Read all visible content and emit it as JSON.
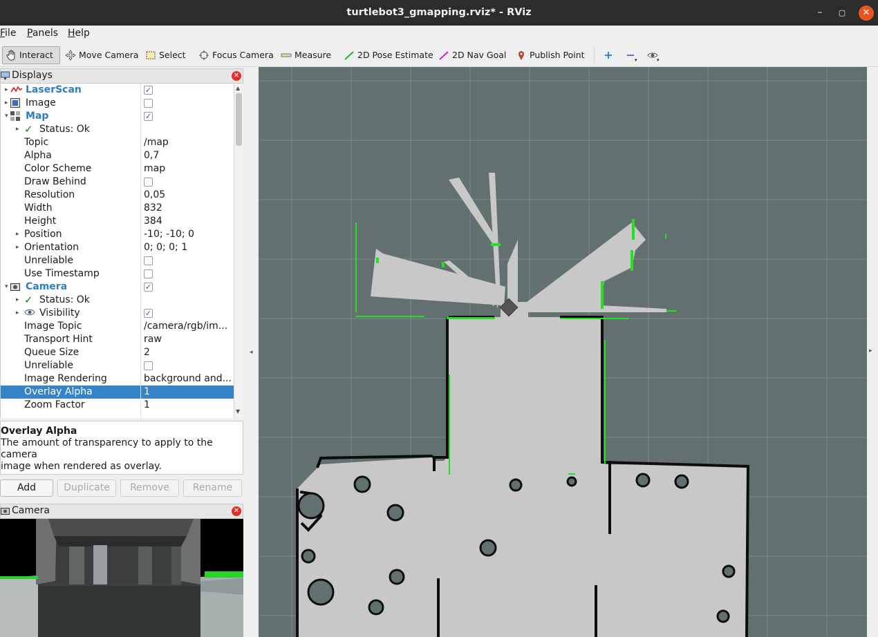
{
  "window": {
    "title": "turtlebot3_gmapping.rviz* - RViz"
  },
  "menu": [
    {
      "label": "File",
      "key": "F",
      "rest": "ile"
    },
    {
      "label": "Panels",
      "key": "P",
      "rest": "anels"
    },
    {
      "label": "Help",
      "key": "H",
      "rest": "elp"
    }
  ],
  "toolbar": {
    "interact": "Interact",
    "move_camera": "Move Camera",
    "select": "Select",
    "focus_camera": "Focus Camera",
    "measure": "Measure",
    "pose_estimate": "2D Pose Estimate",
    "nav_goal": "2D Nav Goal",
    "publish_point": "Publish Point"
  },
  "displays": {
    "title": "Displays",
    "rows": [
      {
        "name": "LaserScan",
        "value": "",
        "checked": true
      },
      {
        "name": "Image",
        "value": "",
        "checked": false
      },
      {
        "name": "Map",
        "value": "",
        "checked": true
      },
      {
        "name": "Status: Ok",
        "value": ""
      },
      {
        "name": "Topic",
        "value": "/map"
      },
      {
        "name": "Alpha",
        "value": "0,7"
      },
      {
        "name": "Color Scheme",
        "value": "map"
      },
      {
        "name": "Draw Behind",
        "value": "",
        "checked": false
      },
      {
        "name": "Resolution",
        "value": "0,05"
      },
      {
        "name": "Width",
        "value": "832"
      },
      {
        "name": "Height",
        "value": "384"
      },
      {
        "name": "Position",
        "value": "-10; -10; 0"
      },
      {
        "name": "Orientation",
        "value": "0; 0; 0; 1"
      },
      {
        "name": "Unreliable",
        "value": "",
        "checked": false
      },
      {
        "name": "Use Timestamp",
        "value": "",
        "checked": false
      },
      {
        "name": "Camera",
        "value": "",
        "checked": true
      },
      {
        "name": "Status: Ok",
        "value": ""
      },
      {
        "name": "Visibility",
        "value": "",
        "checked": true
      },
      {
        "name": "Image Topic",
        "value": "/camera/rgb/im..."
      },
      {
        "name": "Transport Hint",
        "value": "raw"
      },
      {
        "name": "Queue Size",
        "value": "2"
      },
      {
        "name": "Unreliable",
        "value": "",
        "checked": false
      },
      {
        "name": "Image Rendering",
        "value": "background and..."
      },
      {
        "name": "Overlay Alpha",
        "value": "1"
      },
      {
        "name": "Zoom Factor",
        "value": "1"
      }
    ]
  },
  "description": {
    "title": "Overlay Alpha",
    "line1": "The amount of transparency to apply to the camera",
    "line2": "image when rendered as overlay."
  },
  "buttons": {
    "add": "Add",
    "duplicate": "Duplicate",
    "remove": "Remove",
    "rename": "Rename"
  },
  "camera_panel": {
    "title": "Camera"
  },
  "colors": {
    "accent": "#3584c9",
    "map_free": "#c8c8c8",
    "map_unknown": "#627070",
    "laser": "#22e022"
  }
}
